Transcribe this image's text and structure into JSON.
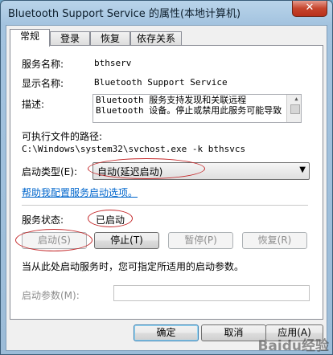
{
  "window": {
    "title": "Bluetooth Support Service 的属性(本地计算机)",
    "close_label": "✕"
  },
  "tabs": [
    {
      "label": "常规",
      "active": true
    },
    {
      "label": "登录"
    },
    {
      "label": "恢复"
    },
    {
      "label": "依存关系"
    }
  ],
  "general": {
    "service_name_label": "服务名称:",
    "service_name_value": "bthserv",
    "display_name_label": "显示名称:",
    "display_name_value": "Bluetooth Support Service",
    "description_label": "描述:",
    "description_lines": [
      "Bluetooth 服务支持发现和关联远程",
      "Bluetooth 设备。停止或禁用此服务可能导致"
    ],
    "exe_path_label": "可执行文件的路径:",
    "exe_path_value": "C:\\Windows\\system32\\svchost.exe -k bthsvcs",
    "startup_type_label": "启动类型(E):",
    "startup_type_value": "自动(延迟启动)",
    "help_link": "帮助我配置服务启动选项。",
    "status_label": "服务状态:",
    "status_value": "已启动",
    "buttons": {
      "start": "启动(S)",
      "stop": "停止(T)",
      "pause": "暂停(P)",
      "resume": "恢复(R)"
    },
    "start_hint": "当从此处启动服务时，您可指定所适用的启动参数。",
    "start_params_label": "启动参数(M):",
    "start_params_value": ""
  },
  "footer": {
    "ok": "确定",
    "cancel": "取消",
    "apply": "应用(A)"
  },
  "watermark": "Baidu经验",
  "colors": {
    "highlight_oval": "#c4282a",
    "link": "#0066cc"
  }
}
